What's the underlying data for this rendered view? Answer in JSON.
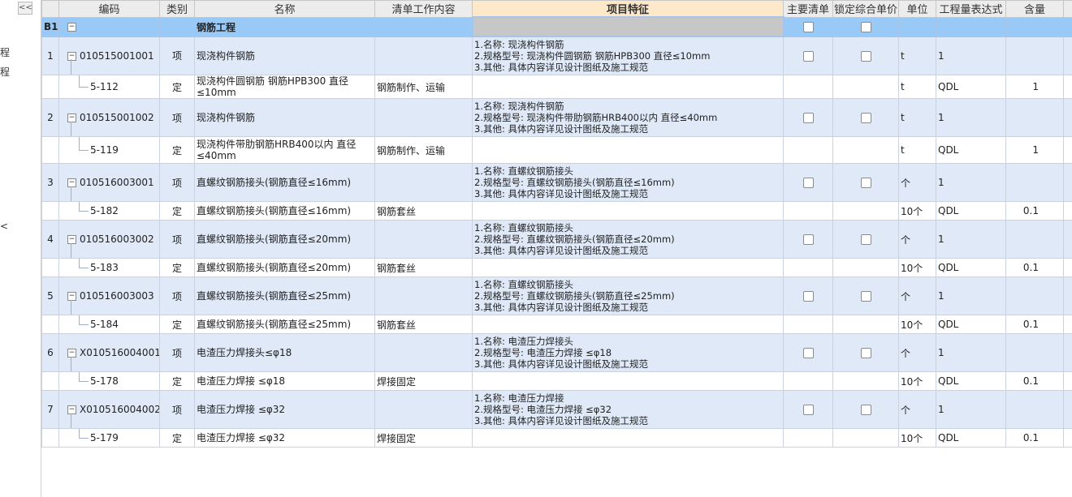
{
  "left_panel": {
    "collapse_label": "<<",
    "fragments": [
      "程",
      "程",
      "<"
    ]
  },
  "columns": [
    "",
    "编码",
    "类别",
    "名称",
    "清单工作内容",
    "项目特征",
    "主要清单",
    "锁定综合单价",
    "单位",
    "工程量表达式",
    "含量"
  ],
  "section": {
    "no": "B1",
    "name": "钢筋工程"
  },
  "rows": [
    {
      "kind": "qd",
      "no": "1",
      "code": "010515001001",
      "type": "项",
      "name": "现浇构件钢筋",
      "work": "",
      "features": [
        "1.名称: 现浇构件钢筋",
        "2.规格型号: 现浇构件圆钢筋 钢筋HPB300 直径≤10mm",
        "3.其他: 具体内容详见设计图纸及施工规范"
      ],
      "unit": "t",
      "expr": "1",
      "qty": ""
    },
    {
      "kind": "de",
      "no": "",
      "code": "5-112",
      "type": "定",
      "name": "现浇构件圆钢筋 钢筋HPB300 直径≤10mm",
      "work": "钢筋制作、运输",
      "features": [],
      "unit": "t",
      "expr": "QDL",
      "qty": "1"
    },
    {
      "kind": "qd",
      "no": "2",
      "code": "010515001002",
      "type": "项",
      "name": "现浇构件钢筋",
      "work": "",
      "features": [
        "1.名称: 现浇构件钢筋",
        "2.规格型号: 现浇构件带肋钢筋HRB400以内 直径≤40mm",
        "3.其他: 具体内容详见设计图纸及施工规范"
      ],
      "unit": "t",
      "expr": "1",
      "qty": ""
    },
    {
      "kind": "de",
      "tall": true,
      "no": "",
      "code": "5-119",
      "type": "定",
      "name": "现浇构件带肋钢筋HRB400以内 直径≤40mm",
      "work": "钢筋制作、运输",
      "features": [],
      "unit": "t",
      "expr": "QDL",
      "qty": "1"
    },
    {
      "kind": "qd",
      "no": "3",
      "code": "010516003001",
      "type": "项",
      "name": "直螺纹钢筋接头(钢筋直径≤16mm)",
      "work": "",
      "features": [
        "1.名称: 直螺纹钢筋接头",
        "2.规格型号: 直螺纹钢筋接头(钢筋直径≤16mm)",
        "3.其他: 具体内容详见设计图纸及施工规范"
      ],
      "unit": "个",
      "expr": "1",
      "qty": ""
    },
    {
      "kind": "de",
      "no": "",
      "code": "5-182",
      "type": "定",
      "name": "直螺纹钢筋接头(钢筋直径≤16mm)",
      "work": "钢筋套丝",
      "features": [],
      "unit": "10个",
      "expr": "QDL",
      "qty": "0.1"
    },
    {
      "kind": "qd",
      "no": "4",
      "code": "010516003002",
      "type": "项",
      "name": "直螺纹钢筋接头(钢筋直径≤20mm)",
      "work": "",
      "features": [
        "1.名称: 直螺纹钢筋接头",
        "2.规格型号: 直螺纹钢筋接头(钢筋直径≤20mm)",
        "3.其他: 具体内容详见设计图纸及施工规范"
      ],
      "unit": "个",
      "expr": "1",
      "qty": ""
    },
    {
      "kind": "de",
      "no": "",
      "code": "5-183",
      "type": "定",
      "name": "直螺纹钢筋接头(钢筋直径≤20mm)",
      "work": "钢筋套丝",
      "features": [],
      "unit": "10个",
      "expr": "QDL",
      "qty": "0.1"
    },
    {
      "kind": "qd",
      "no": "5",
      "code": "010516003003",
      "type": "项",
      "name": "直螺纹钢筋接头(钢筋直径≤25mm)",
      "work": "",
      "features": [
        "1.名称: 直螺纹钢筋接头",
        "2.规格型号: 直螺纹钢筋接头(钢筋直径≤25mm)",
        "3.其他: 具体内容详见设计图纸及施工规范"
      ],
      "unit": "个",
      "expr": "1",
      "qty": ""
    },
    {
      "kind": "de",
      "no": "",
      "code": "5-184",
      "type": "定",
      "name": "直螺纹钢筋接头(钢筋直径≤25mm)",
      "work": "钢筋套丝",
      "features": [],
      "unit": "10个",
      "expr": "QDL",
      "qty": "0.1"
    },
    {
      "kind": "qd",
      "no": "6",
      "code": "X010516004001",
      "type": "项",
      "name": "电渣压力焊接头≤φ18",
      "work": "",
      "features": [
        "1.名称: 电渣压力焊接头",
        "2.规格型号: 电渣压力焊接 ≤φ18",
        "3.其他: 具体内容详见设计图纸及施工规范"
      ],
      "unit": "个",
      "expr": "1",
      "qty": ""
    },
    {
      "kind": "de",
      "no": "",
      "code": "5-178",
      "type": "定",
      "name": "电渣压力焊接 ≤φ18",
      "work": "焊接固定",
      "features": [],
      "unit": "10个",
      "expr": "QDL",
      "qty": "0.1"
    },
    {
      "kind": "qd",
      "no": "7",
      "code": "X010516004002",
      "type": "项",
      "name": "电渣压力焊接 ≤φ32",
      "work": "",
      "features": [
        "1.名称: 电渣压力焊接",
        "2.规格型号: 电渣压力焊接 ≤φ32",
        "3.其他: 具体内容详见设计图纸及施工规范"
      ],
      "unit": "个",
      "expr": "1",
      "qty": ""
    },
    {
      "kind": "de",
      "no": "",
      "code": "5-179",
      "type": "定",
      "name": "电渣压力焊接 ≤φ32",
      "work": "焊接固定",
      "features": [],
      "unit": "10个",
      "expr": "QDL",
      "qty": "0.1"
    }
  ],
  "colors": {
    "section_bg": "#99c9f7",
    "qd_bg": "#dfe9f8",
    "header_bg": "#ececec",
    "feature_header_bg": "#fde9c9"
  }
}
